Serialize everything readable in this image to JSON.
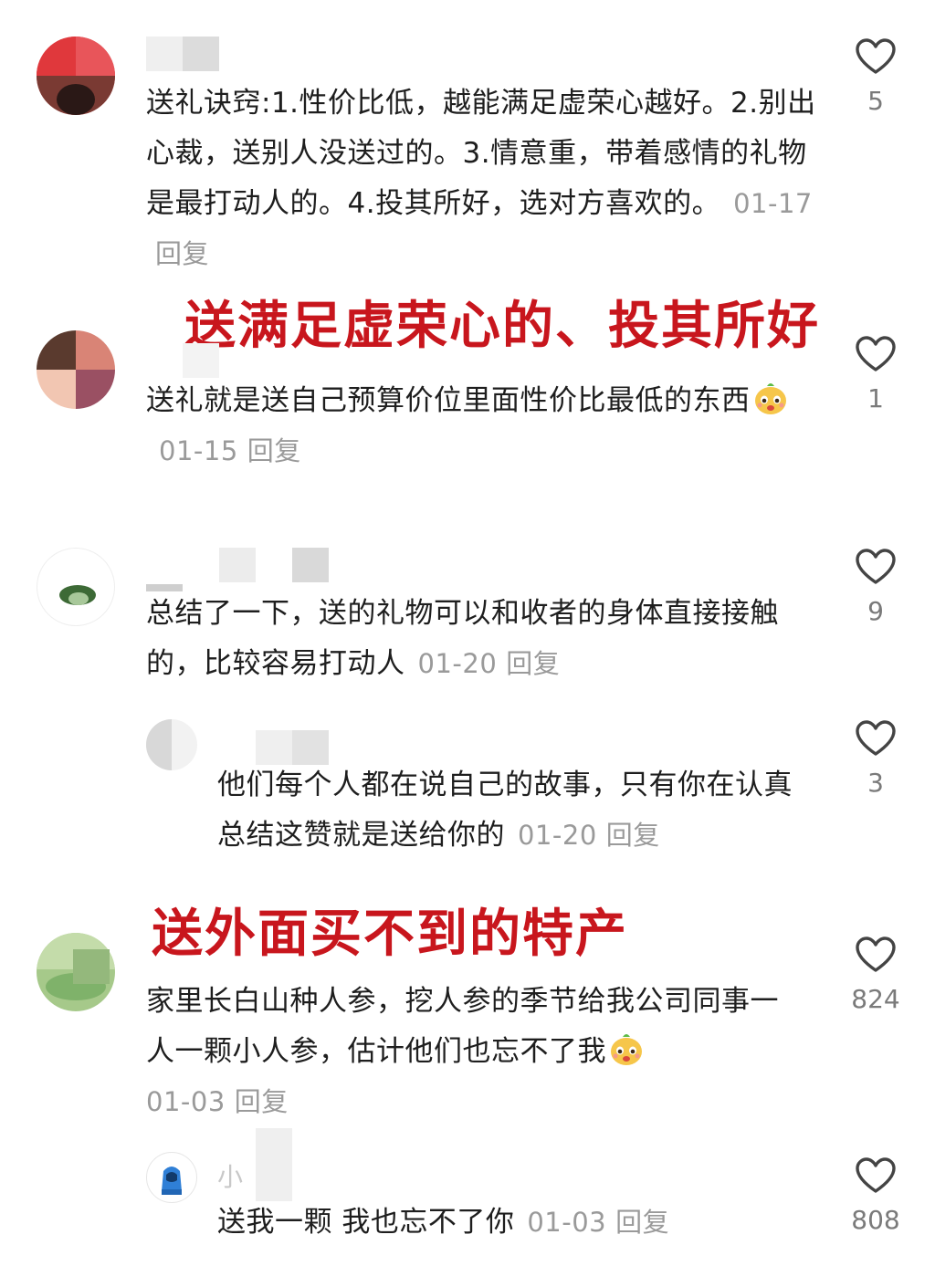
{
  "comments": [
    {
      "text": "送礼诀窍:1.性价比低，越能满足虚荣心越好。2.别出心裁，送别人没送过的。3.情意重，带着感情的礼物是最打动人的。4.投其所好，选对方喜欢的。",
      "date": "01-17",
      "reply": "回复",
      "likes": "5"
    },
    {
      "text": "送礼就是送自己预算价位里面性价比最低的东西",
      "date": "01-15",
      "reply": "回复",
      "likes": "1"
    },
    {
      "text": "总结了一下，送的礼物可以和收者的身体直接接触的，比较容易打动人",
      "date": "01-20",
      "reply": "回复",
      "likes": "9"
    },
    {
      "text": "他们每个人都在说自己的故事，只有你在认真总结这赞就是送给你的",
      "date": "01-20",
      "reply": "回复",
      "likes": "3"
    },
    {
      "text": "家里长白山种人参，挖人参的季节给我公司同事一人一颗小人参，估计他们也忘不了我",
      "date": "01-03",
      "reply": "回复",
      "likes": "824"
    },
    {
      "text": "送我一颗 我也忘不了你",
      "date": "01-03",
      "reply": "回复",
      "likes": "808",
      "username_initial": "小"
    }
  ],
  "annotations": {
    "first": "送满足虚荣心的、投其所好",
    "second": "送外面买不到的特产"
  },
  "colors": {
    "annotation": "#c8161d",
    "meta": "#9a9a9a"
  },
  "icons": {
    "like": "heart-outline-icon",
    "emoji": "smiling-face-emoji-icon"
  }
}
